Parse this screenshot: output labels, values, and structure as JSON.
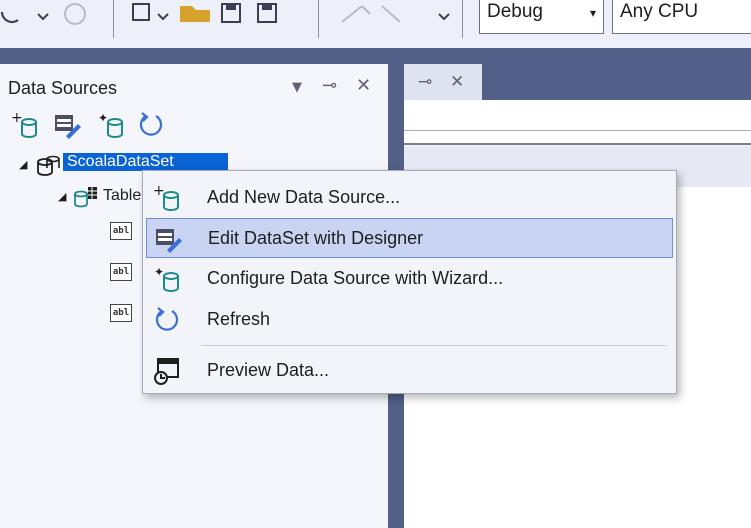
{
  "toolbar": {
    "configuration_value": "Debug",
    "platform_value": "Any CPU"
  },
  "panel": {
    "title": "Data Sources",
    "tools": [
      "add-data-source-icon",
      "edit-dataset-designer-icon",
      "configure-wizard-icon",
      "refresh-icon"
    ]
  },
  "tree": {
    "dataset_label": "ScoalaDataSet",
    "table_label": "Table",
    "column_icon_text": "abl"
  },
  "context_menu": {
    "items": [
      {
        "label": "Add New Data Source...",
        "icon": "add-data-source-icon"
      },
      {
        "label": "Edit DataSet with Designer",
        "icon": "edit-dataset-designer-icon",
        "highlighted": true
      },
      {
        "label": "Configure Data Source with Wizard...",
        "icon": "configure-wizard-icon"
      },
      {
        "label": "Refresh",
        "icon": "refresh-icon"
      },
      {
        "label": "Preview Data...",
        "icon": "preview-data-icon"
      }
    ]
  },
  "colors": {
    "accent_selection": "#0a64d6",
    "menu_highlight": "#c9d4f3",
    "frame_navy": "#525f87",
    "icon_teal": "#1d8a8a"
  }
}
